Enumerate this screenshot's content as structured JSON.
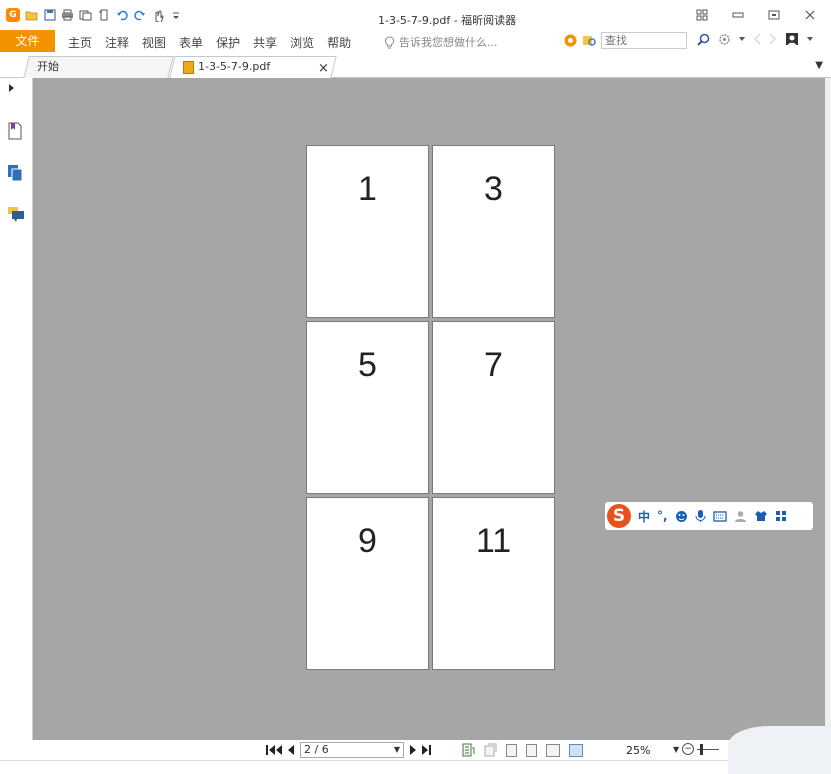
{
  "window": {
    "title": "1-3-5-7-9.pdf - 福昕阅读器"
  },
  "menubar": {
    "file_label": "文件",
    "items": [
      "主页",
      "注释",
      "视图",
      "表单",
      "保护",
      "共享",
      "浏览",
      "帮助"
    ],
    "tell_me_placeholder": "告诉我您想做什么...",
    "search_placeholder": "查找"
  },
  "tabs": {
    "home_label": "开始",
    "doc_label": "1-3-5-7-9.pdf",
    "close_glyph": "×"
  },
  "document": {
    "pages": [
      "1",
      "3",
      "5",
      "7",
      "9",
      "11"
    ]
  },
  "ime": {
    "logo": "S",
    "mode_label": "中",
    "punct_label": "°,"
  },
  "statusbar": {
    "page_indicator": "2 / 6",
    "zoom_level": "25%"
  },
  "colors": {
    "accent": "#f29200",
    "doc_background": "#a6a6a6",
    "ime_red": "#e8501e"
  }
}
